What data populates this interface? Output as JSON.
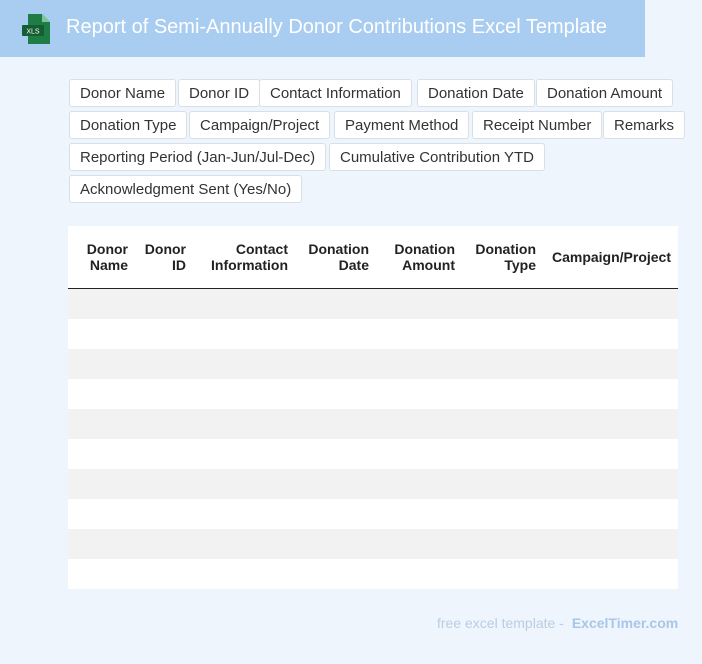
{
  "title": "Report of Semi-Annually Donor Contributions Excel Template",
  "icon": {
    "name": "xls-file-icon",
    "label": "XLS",
    "color": "#1e7c45"
  },
  "tags": [
    "Donor Name",
    "Donor ID",
    "Contact Information",
    "Donation Date",
    "Donation Amount",
    "Donation Type",
    "Campaign/Project",
    "Payment Method",
    "Receipt Number",
    "Remarks",
    "Reporting Period (Jan-Jun/Jul-Dec)",
    "Cumulative Contribution YTD",
    "Acknowledgment Sent (Yes/No)"
  ],
  "table": {
    "headers": [
      [
        "Donor",
        "Name"
      ],
      [
        "Donor",
        "ID"
      ],
      [
        "Contact",
        "Information"
      ],
      [
        "Donation",
        "Date"
      ],
      [
        "Donation",
        "Amount"
      ],
      [
        "Donation",
        "Type"
      ],
      [
        "Campaign/Project"
      ]
    ],
    "row_count": 10
  },
  "footer": {
    "text": "free excel template -",
    "brand": "ExcelTimer.com"
  }
}
